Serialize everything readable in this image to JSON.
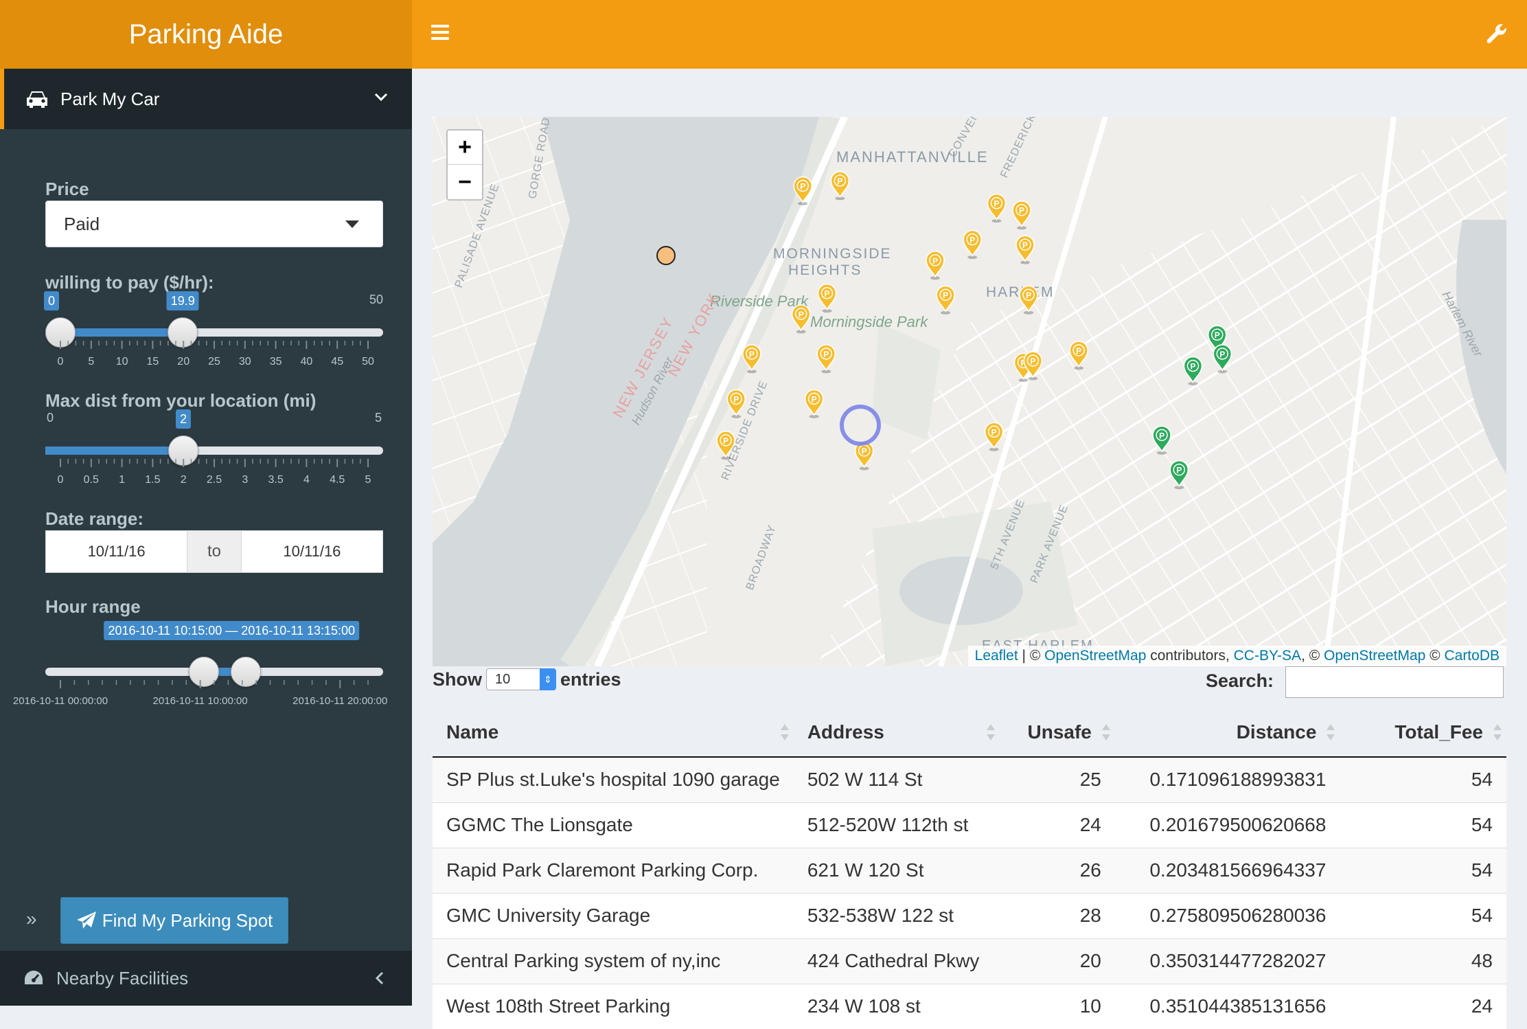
{
  "app": {
    "title": "Parking Aide"
  },
  "sidebar": {
    "menu_title": "Park My Car",
    "price_label": "Price",
    "price_value": "Paid",
    "pay_label": "willing to pay ($/hr):",
    "pay_slider": {
      "min": 0,
      "max": 50,
      "value": 19.9,
      "min_text": "0",
      "max_text": "50",
      "value_text": "19.9",
      "ticks": [
        "0",
        "5",
        "10",
        "15",
        "20",
        "25",
        "30",
        "35",
        "40",
        "45",
        "50"
      ]
    },
    "dist_label": "Max dist from your location (mi)",
    "dist_slider": {
      "min": 0,
      "max": 5,
      "value": 2,
      "min_text": "0",
      "max_text": "5",
      "value_text": "2",
      "ticks": [
        "0",
        "0.5",
        "1",
        "1.5",
        "2",
        "2.5",
        "3",
        "3.5",
        "4",
        "4.5",
        "5"
      ]
    },
    "date_label": "Date range:",
    "date_start": "10/11/16",
    "date_sep": "to",
    "date_end": "10/11/16",
    "hour_label": "Hour range",
    "hour_slider": {
      "min_hours": 0,
      "max_hours": 22,
      "start_hours": 10.25,
      "end_hours": 13.25,
      "value_text": "2016-10-11 10:15:00 — 2016-10-11 13:15:00",
      "ticks": [
        "2016-10-11 00:00:00",
        "2016-10-11 10:00:00",
        "2016-10-11 20:00:00"
      ]
    },
    "collapse_glyph": "»",
    "find_button": "Find My Parking Spot",
    "menu2_title": "Nearby Facilities"
  },
  "map": {
    "labels": [
      "MANHATTANVILLE",
      "MORNINGSIDE",
      "HEIGHTS",
      "HARLEM",
      "Riverside Park",
      "Morningside Park",
      "NEW JERSEY",
      "NEW YORK",
      "Hudson River",
      "RIVERSIDE DRIVE",
      "BROADWAY",
      "5TH AVENUE",
      "PARK AVENUE",
      "EAST HARLEM",
      "Harlem River",
      "PALISADE AVENUE",
      "GORGE ROAD",
      "CONVENT",
      "FREDERICK"
    ],
    "marker_glyph": "P",
    "colors": {
      "water": "#d4dadc",
      "land": "#f5f3f0",
      "park": "#e4e6e2",
      "yellow_marker": "#f6bd2f",
      "green_marker": "#2eaa5c",
      "user": "#f7be7e"
    },
    "attribution": {
      "leaflet": "Leaflet",
      "sep1": " | © ",
      "osm": "OpenStreetMap",
      "contrib": " contributors, ",
      "cc": "CC-BY-SA",
      "sep2": ", © ",
      "osm2": "OpenStreetMap",
      "sep3": " © ",
      "carto": "CartoDB"
    }
  },
  "table": {
    "show_label": "Show",
    "length_value": "10",
    "entries_label": "entries",
    "search_label": "Search:",
    "headers": [
      "Name",
      "Address",
      "Unsafe",
      "Distance",
      "Total_Fee"
    ],
    "rows": [
      [
        "SP Plus st.Luke's hospital 1090 garage",
        "502 W 114 St",
        "25",
        "0.171096188993831",
        "54"
      ],
      [
        "GGMC The Lionsgate",
        "512-520W 112th st",
        "24",
        "0.201679500620668",
        "54"
      ],
      [
        "Rapid Park Claremont Parking Corp.",
        "621 W 120 St",
        "26",
        "0.203481566964337",
        "54"
      ],
      [
        "GMC University Garage",
        "532-538W 122 st",
        "28",
        "0.275809506280036",
        "54"
      ],
      [
        "Central Parking system of ny,inc",
        "424 Cathedral Pkwy",
        "20",
        "0.350314477282027",
        "48"
      ],
      [
        "West 108th Street Parking",
        "234 W 108 st",
        "10",
        "0.351044385131656",
        "24"
      ]
    ]
  },
  "theme": {
    "header": "#f39c12",
    "logo": "#e08e0b",
    "sidebar": "#222d32",
    "accent_blue": "#428bca"
  }
}
